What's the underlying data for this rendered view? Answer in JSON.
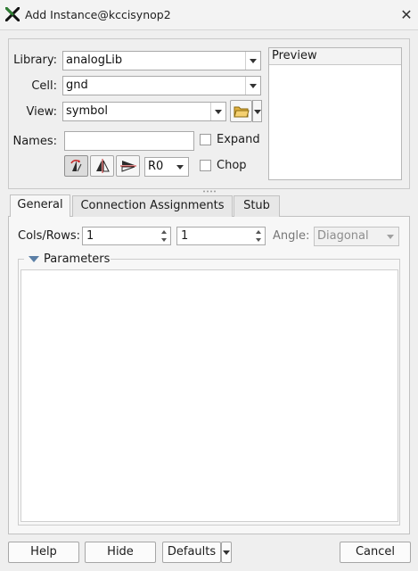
{
  "window": {
    "title": "Add Instance@kccisynop2",
    "app_icon": "x-app-icon",
    "close_glyph": "✕"
  },
  "form": {
    "library_label": "Library:",
    "library_value": "analogLib",
    "cell_label": "Cell:",
    "cell_value": "gnd",
    "view_label": "View:",
    "view_value": "symbol",
    "names_label": "Names:",
    "names_value": "",
    "expand_label": "Expand",
    "chop_label": "Chop",
    "rotation_value": "R0"
  },
  "preview": {
    "label": "Preview"
  },
  "tabs": [
    {
      "label": "General",
      "active": true
    },
    {
      "label": "Connection Assignments",
      "active": false
    },
    {
      "label": "Stub",
      "active": false
    }
  ],
  "general": {
    "cols_rows_label": "Cols/Rows:",
    "cols_value": "1",
    "rows_value": "1",
    "angle_label": "Angle:",
    "angle_value": "Diagonal",
    "parameters_label": "Parameters"
  },
  "footer": {
    "help": "Help",
    "hide": "Hide",
    "defaults": "Defaults",
    "cancel": "Cancel"
  },
  "colors": {
    "window_bg": "#efefef",
    "accent_icon": "#2e7d32"
  }
}
